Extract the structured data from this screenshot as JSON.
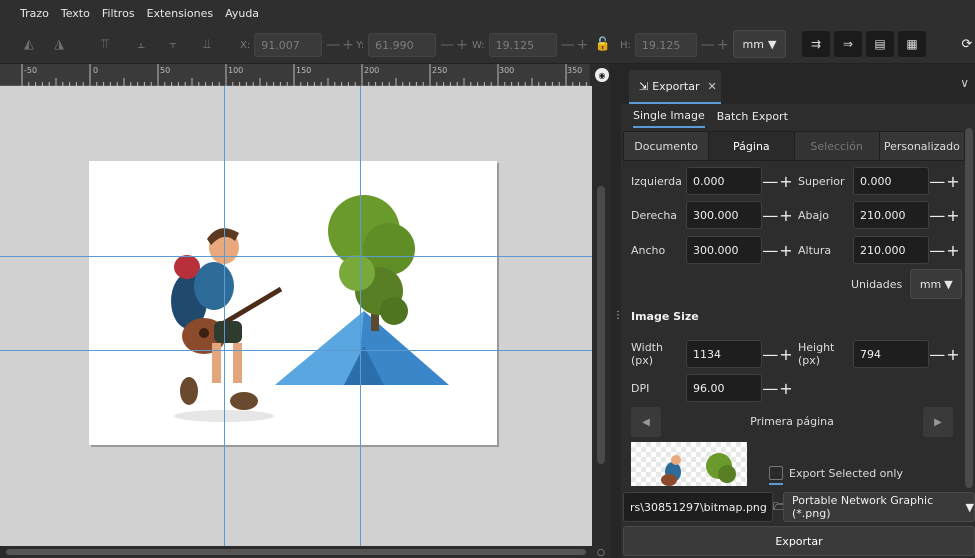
{
  "menu": [
    "Trazo",
    "Texto",
    "Filtros",
    "Extensiones",
    "Ayuda"
  ],
  "toolbar": {
    "x_label": "X:",
    "x_value": "91.007",
    "y_label": "Y:",
    "y_value": "61.990",
    "w_label": "W:",
    "w_value": "19.125",
    "h_label": "H:",
    "h_value": "19.125",
    "unit": "mm"
  },
  "ruler": [
    "-50",
    "0",
    "50",
    "100",
    "150",
    "200",
    "250",
    "300",
    "350"
  ],
  "panel": {
    "tab_title": "Exportar",
    "subtabs": [
      "Single Image",
      "Batch Export"
    ],
    "area_tabs": [
      "Documento",
      "Página",
      "Selección",
      "Personalizado"
    ],
    "fields": {
      "izquierda_label": "Izquierda",
      "izquierda": "0.000",
      "superior_label": "Superior",
      "superior": "0.000",
      "derecha_label": "Derecha",
      "derecha": "300.000",
      "abajo_label": "Abajo",
      "abajo": "210.000",
      "ancho_label": "Ancho",
      "ancho": "300.000",
      "altura_label": "Altura",
      "altura": "210.000"
    },
    "units_label": "Unidades",
    "units_value": "mm",
    "image_size_title": "Image Size",
    "width_label": "Width (px)",
    "width_value": "1134",
    "height_label": "Height (px)",
    "height_value": "794",
    "dpi_label": "DPI",
    "dpi_value": "96.00",
    "page_label": "Primera página",
    "export_selected_only": "Export Selected only",
    "filename": "rs\\30851297\\bitmap.png",
    "format": "Portable Network Graphic (*.png)",
    "export_button": "Exportar"
  }
}
